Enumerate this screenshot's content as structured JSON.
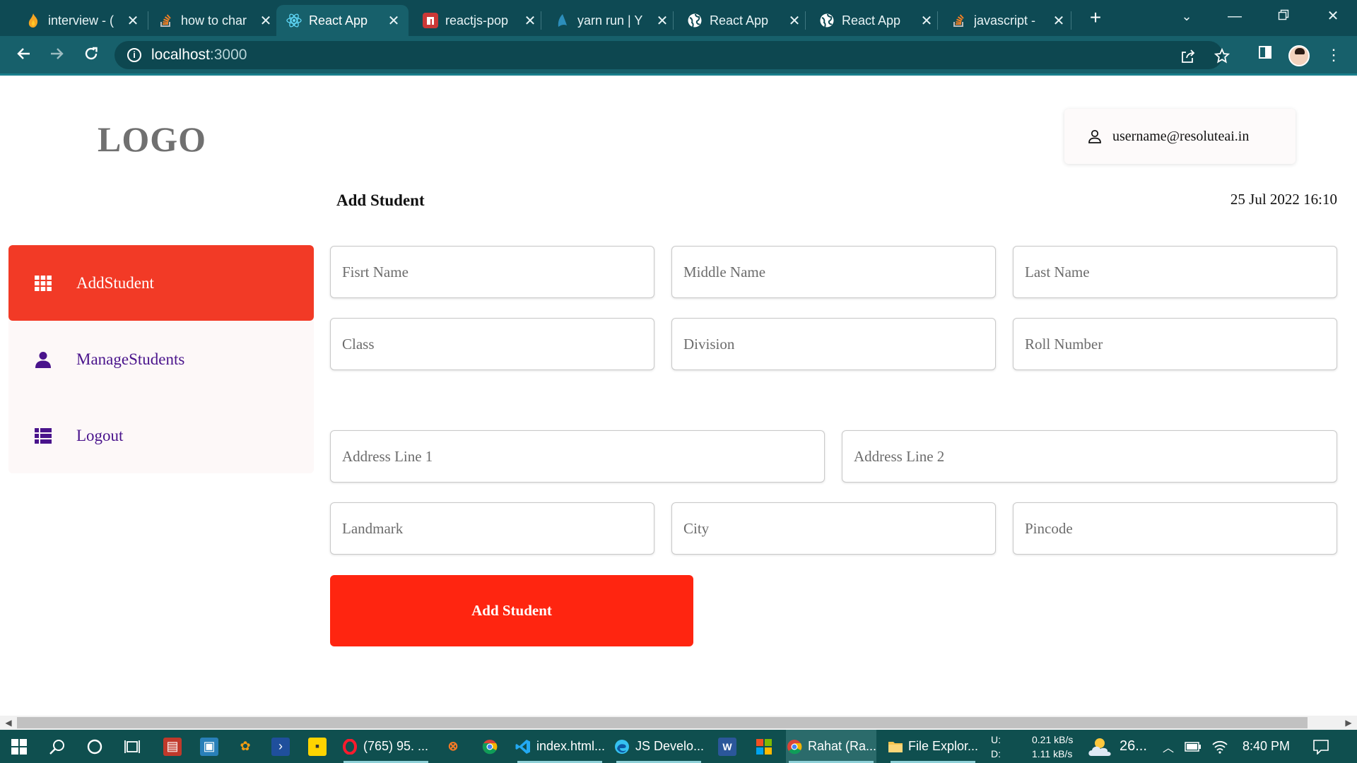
{
  "browser": {
    "tabs": [
      {
        "title": "interview - (",
        "icon": "fire-icon",
        "color": "#f5a623",
        "active": false
      },
      {
        "title": "how to char",
        "icon": "stackoverflow-icon",
        "color": "#f48024",
        "active": false
      },
      {
        "title": "React App",
        "icon": "react-icon",
        "color": "#61dafb",
        "active": true
      },
      {
        "title": "reactjs-pop",
        "icon": "npm-icon",
        "color": "#cb3837",
        "active": false
      },
      {
        "title": "yarn run | Y",
        "icon": "yarn-icon",
        "color": "#2c8ebb",
        "active": false
      },
      {
        "title": "React App",
        "icon": "globe-icon",
        "color": "#ffffff",
        "active": false
      },
      {
        "title": "React App",
        "icon": "globe-icon",
        "color": "#ffffff",
        "active": false
      },
      {
        "title": "javascript -",
        "icon": "stackoverflow-icon",
        "color": "#f48024",
        "active": false
      }
    ],
    "url_host": "localhost",
    "url_port": ":3000"
  },
  "app": {
    "logo": "LOGO",
    "user_email": "username@resoluteai.in",
    "page_title": "Add Student",
    "datetime": "25 Jul 2022 16:10",
    "sidebar": [
      {
        "label": "AddStudent",
        "icon": "grid-icon",
        "active": true
      },
      {
        "label": "ManageStudents",
        "icon": "person-icon",
        "active": false
      },
      {
        "label": "Logout",
        "icon": "list-icon",
        "active": false
      }
    ],
    "form": {
      "first_name": "Fisrt Name",
      "middle_name": "Middle Name",
      "last_name": "Last Name",
      "class": "Class",
      "division": "Division",
      "roll_number": "Roll Number",
      "address_line_1": "Address Line 1",
      "address_line_2": "Address Line 2",
      "landmark": "Landmark",
      "city": "City",
      "pincode": "Pincode",
      "submit_label": "Add Student"
    },
    "colors": {
      "accent": "#ff2510",
      "active_nav": "#f23a26",
      "nav_text": "#4a148c"
    }
  },
  "taskbar": {
    "items": [
      {
        "label": "(765) 95. ...",
        "icon": "opera-icon",
        "color": "#ff1b2d"
      },
      {
        "label": "index.html...",
        "icon": "vscode-icon",
        "color": "#23a9f2"
      },
      {
        "label": "JS Develo...",
        "icon": "edge-icon",
        "color": "#35c1f1"
      },
      {
        "label": "Rahat (Ra...",
        "icon": "chrome-icon",
        "color": "#4caf50"
      },
      {
        "label": "File Explor...",
        "icon": "folder-icon",
        "color": "#f8c44f"
      }
    ],
    "net_up_label": "U:",
    "net_down_label": "D:",
    "net_up": "0.21 kB/s",
    "net_down": "1.11 kB/s",
    "weather": "26...",
    "time": "8:40 PM"
  }
}
